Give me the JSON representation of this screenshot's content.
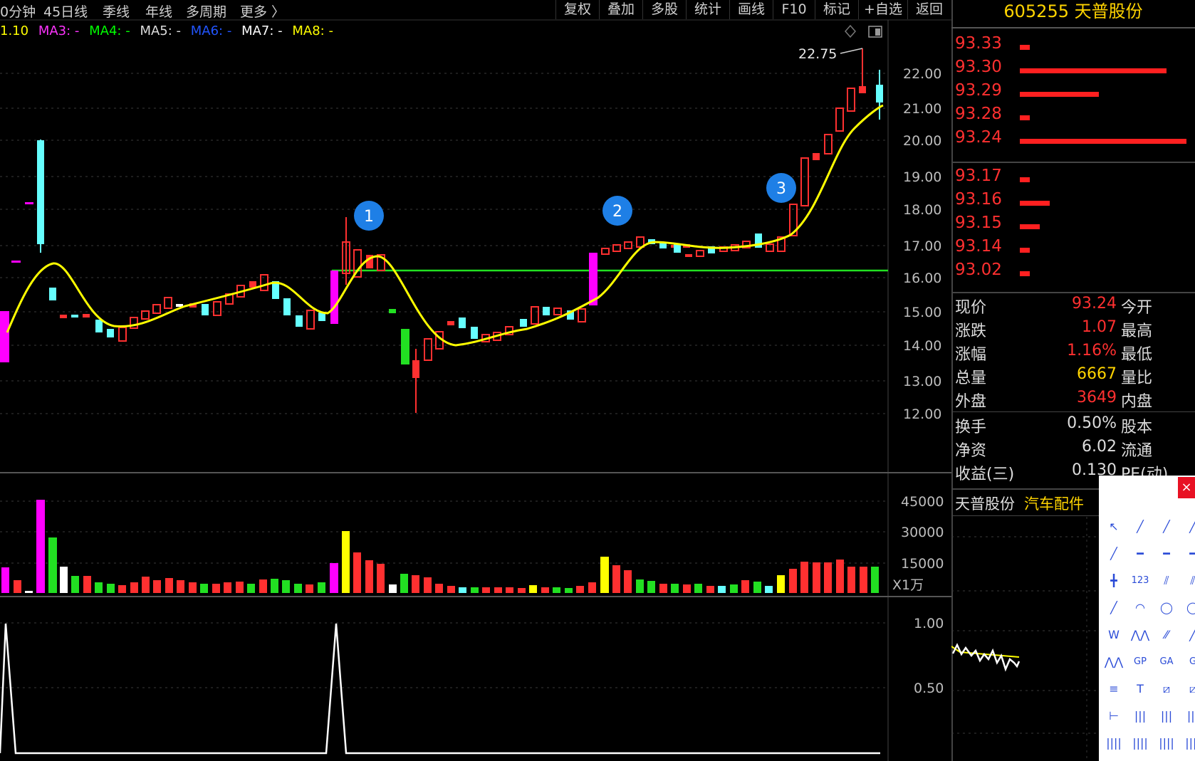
{
  "topbar": {
    "periods": [
      "0分钟",
      "45日线",
      "季线",
      "年线",
      "多周期",
      "更多 〉"
    ],
    "buttons": [
      "复权",
      "叠加",
      "多股",
      "统计",
      "画线",
      "F10",
      "标记",
      "+自选",
      "返回"
    ]
  },
  "ma_legend": [
    {
      "label": "1.10",
      "color": "#ffff00"
    },
    {
      "label": "MA3: -",
      "color": "#ff33ff"
    },
    {
      "label": "MA4: -",
      "color": "#00ff00"
    },
    {
      "label": "MA5: -",
      "color": "#dddddd"
    },
    {
      "label": "MA6: -",
      "color": "#2255ff"
    },
    {
      "label": "MA7: -",
      "color": "#ffffff"
    },
    {
      "label": "MA8: -",
      "color": "#ffff00"
    }
  ],
  "chart_icons": [
    "diamond-icon",
    "panel-toggle-icon"
  ],
  "price_axis": [
    "22.00",
    "21.00",
    "20.00",
    "19.00",
    "18.00",
    "17.00",
    "16.00",
    "15.00",
    "14.00",
    "13.00",
    "12.00"
  ],
  "volume_axis": [
    "45000",
    "30000",
    "15000"
  ],
  "volume_unit": "X1万",
  "indicator_axis": [
    "1.00",
    "0.50"
  ],
  "high_annotation": "22.75",
  "markers": [
    "1",
    "2",
    "3"
  ],
  "stock": {
    "code": "605255",
    "name": "天普股份"
  },
  "order_book": [
    {
      "price": "93.33",
      "bar": 0.05
    },
    {
      "price": "93.30",
      "bar": 0.75
    },
    {
      "price": "93.29",
      "bar": 0.4
    },
    {
      "price": "93.28",
      "bar": 0.05
    },
    {
      "price": "93.24",
      "bar": 0.9
    },
    {
      "price": "93.17",
      "bar": 0.05
    },
    {
      "price": "93.16",
      "bar": 0.15
    },
    {
      "price": "93.15",
      "bar": 0.1
    },
    {
      "price": "93.14",
      "bar": 0.05
    },
    {
      "price": "93.02",
      "bar": 0.05
    }
  ],
  "quote": [
    {
      "label": "现价",
      "value": "93.24",
      "color": "#ff3030",
      "right": "今开"
    },
    {
      "label": "涨跌",
      "value": "1.07",
      "color": "#ff3030",
      "right": "最高"
    },
    {
      "label": "涨幅",
      "value": "1.16%",
      "color": "#ff3030",
      "right": "最低"
    },
    {
      "label": "总量",
      "value": "6667",
      "color": "#ffd400",
      "right": "量比"
    },
    {
      "label": "外盘",
      "value": "3649",
      "color": "#ff3030",
      "right": "内盘"
    },
    {
      "label": "换手",
      "value": "0.50%",
      "color": "#dddddd",
      "right": "股本"
    },
    {
      "label": "净资",
      "value": "6.02",
      "color": "#dddddd",
      "right": "流通"
    },
    {
      "label": "收益(三)",
      "value": "0.130",
      "color": "#dddddd",
      "right": "PE(动)"
    }
  ],
  "bottom_tabs": {
    "stock": "天普股份",
    "sector": "汽车配件"
  },
  "toolbox": {
    "close": "×",
    "tools": [
      "↖",
      "╱",
      "╱",
      "╱",
      "╱",
      "━",
      "━",
      "━",
      "╋",
      "123",
      "⫽",
      "⫽",
      "╱",
      "◠",
      "◯",
      "◯",
      "W",
      "⋀⋀",
      "⁄⁄",
      "╱",
      "⋀⋀",
      "GP",
      "GA",
      "G",
      "≡",
      "T",
      "⧄",
      "⧄",
      "⊢",
      "|||",
      "|||",
      "|||",
      "||||",
      "||||",
      "||||",
      "||||"
    ]
  }
}
